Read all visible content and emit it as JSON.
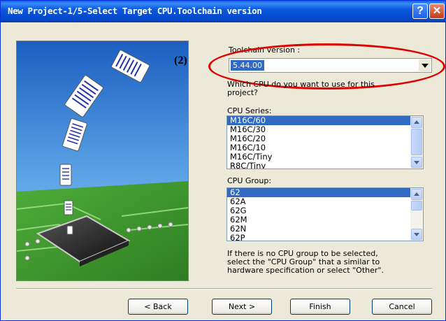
{
  "window": {
    "title": "New Project-1/5-Select Target CPU.Toolchain version",
    "help_glyph": "?",
    "close_glyph": "✕"
  },
  "annotation": {
    "label": "(2)",
    "highlight_color": "#e00000"
  },
  "toolchain": {
    "label": "Toolchain version :",
    "value": "5.44.00"
  },
  "cpu_question": {
    "line1": "Which CPU do you want to use for this",
    "line2": "project?"
  },
  "cpu_series": {
    "label": "CPU Series:",
    "items": [
      "M16C/60",
      "M16C/30",
      "M16C/20",
      "M16C/10",
      "M16C/Tiny",
      "R8C/Tiny"
    ],
    "selected_index": 0
  },
  "cpu_group": {
    "label": "CPU Group:",
    "items": [
      "62",
      "62A",
      "62G",
      "62M",
      "62N",
      "62P"
    ],
    "selected_index": 0
  },
  "hint": {
    "line1": "If there is no CPU group to be selected,",
    "line2": "select the \"CPU Group\" that a similar to",
    "line3": "hardware specification or select \"Other\"."
  },
  "buttons": {
    "back": "< Back",
    "next": "Next >",
    "finish": "Finish",
    "cancel": "Cancel"
  },
  "colors": {
    "titlebar": "#0a58e0",
    "selection": "#316ac5",
    "dialog_bg": "#ece9d8"
  }
}
